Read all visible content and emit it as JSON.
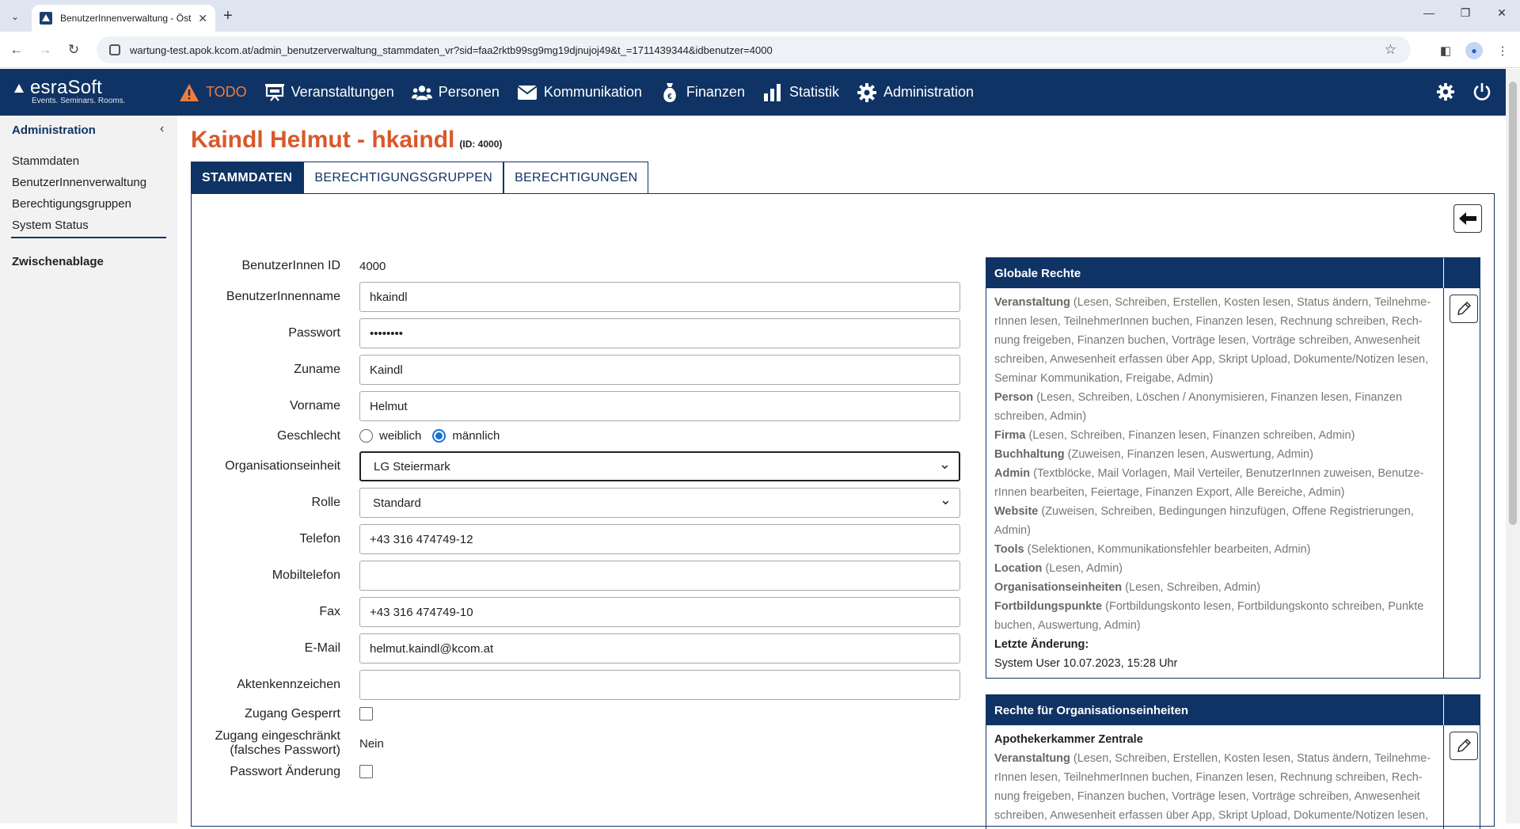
{
  "browser": {
    "tab_title": "BenutzerInnenverwaltung - Öst",
    "tab_close": "✕",
    "new_tab": "+",
    "url": "wartung-test.apok.kcom.at/admin_benutzerverwaltung_stammdaten_vr?sid=faa2rktb99sg9mg19djnujoj49&t_=1711439344&idbenutzer=4000",
    "win_minimize": "—",
    "win_restore": "❐",
    "win_close": "✕"
  },
  "app": {
    "logo": "esraSoft",
    "logo_tagline": "Events. Seminars. Rooms.",
    "menu": [
      {
        "label": "TODO",
        "icon": "warning-icon"
      },
      {
        "label": "Veranstaltungen",
        "icon": "presentation-icon"
      },
      {
        "label": "Personen",
        "icon": "people-icon"
      },
      {
        "label": "Kommunikation",
        "icon": "envelope-icon"
      },
      {
        "label": "Finanzen",
        "icon": "money-bag-icon"
      },
      {
        "label": "Statistik",
        "icon": "bar-chart-icon"
      },
      {
        "label": "Administration",
        "icon": "gear-icon"
      }
    ],
    "colors": {
      "header": "#0f3364",
      "accent": "#d9582a",
      "todo": "#f07d3e"
    }
  },
  "sidebar": {
    "heading": "Administration",
    "items": [
      "Stammdaten",
      "BenutzerInnenverwaltung",
      "Berechtigungsgruppen",
      "System Status"
    ],
    "clipboard": "Zwischenablage"
  },
  "page": {
    "title": "Kaindl Helmut - hkaindl",
    "id_label": "(ID: 4000)",
    "tabs": [
      "STAMMDATEN",
      "BERECHTIGUNGSGRUPPEN",
      "BERECHTIGUNGEN"
    ]
  },
  "form": {
    "id_label": "BenutzerInnen ID",
    "id_value": "4000",
    "username_label": "BenutzerInnenname",
    "username_value": "hkaindl",
    "password_label": "Passwort",
    "password_value": "••••••••",
    "lastname_label": "Zuname",
    "lastname_value": "Kaindl",
    "firstname_label": "Vorname",
    "firstname_value": "Helmut",
    "gender_label": "Geschlecht",
    "gender_female": "weiblich",
    "gender_male": "männlich",
    "org_label": "Organisationseinheit",
    "org_value": "LG Steiermark",
    "role_label": "Rolle",
    "role_value": "Standard",
    "phone_label": "Telefon",
    "phone_value": "+43 316 474749-12",
    "mobile_label": "Mobiltelefon",
    "mobile_value": "",
    "fax_label": "Fax",
    "fax_value": "+43 316 474749-10",
    "email_label": "E-Mail",
    "email_value": "helmut.kaindl@kcom.at",
    "fileref_label": "Aktenkennzeichen",
    "fileref_value": "",
    "locked_label": "Zugang Gesperrt",
    "restricted_label_1": "Zugang eingeschränkt",
    "restricted_label_2": "(falsches Passwort)",
    "restricted_value": "Nein",
    "pwchange_label": "Passwort Änderung"
  },
  "global_rights": {
    "title": "Globale Rechte",
    "entries": [
      {
        "name": "Veranstaltung",
        "text": " (Lesen, Schreiben, Erstellen, Kosten lesen, Status ändern, Teilnehme-"
      },
      {
        "name": "",
        "text": "rInnen lesen, TeilnehmerInnen buchen, Finanzen lesen, Rechnung schreiben, Rech-"
      },
      {
        "name": "",
        "text": "nung freigeben, Finanzen buchen, Vorträge lesen, Vorträge schreiben, Anwesenheit"
      },
      {
        "name": "",
        "text": "schreiben, Anwesenheit erfassen über App, Skript Upload, Dokumente/Notizen lesen,"
      },
      {
        "name": "",
        "text": "Seminar Kommunikation, Freigabe, Admin)"
      },
      {
        "name": "Person",
        "text": " (Lesen, Schreiben, Löschen / Anonymisieren, Finanzen lesen, Finanzen"
      },
      {
        "name": "",
        "text": "schreiben, Admin)"
      },
      {
        "name": "Firma",
        "text": " (Lesen, Schreiben, Finanzen lesen, Finanzen schreiben, Admin)"
      },
      {
        "name": "Buchhaltung",
        "text": " (Zuweisen, Finanzen lesen, Auswertung, Admin)"
      },
      {
        "name": "Admin",
        "text": " (Textblöcke, Mail Vorlagen, Mail Verteiler, BenutzerInnen zuweisen, Benutze-"
      },
      {
        "name": "",
        "text": "rInnen bearbeiten, Feiertage, Finanzen Export, Alle Bereiche, Admin)"
      },
      {
        "name": "Website",
        "text": " (Zuweisen, Schreiben, Bedingungen hinzufügen, Offene Registrierungen,"
      },
      {
        "name": "",
        "text": "Admin)"
      },
      {
        "name": "Tools",
        "text": " (Selektionen, Kommunikationsfehler bearbeiten, Admin)"
      },
      {
        "name": "Location",
        "text": " (Lesen, Admin)"
      },
      {
        "name": "Organisationseinheiten",
        "text": " (Lesen, Schreiben, Admin)"
      },
      {
        "name": "Fortbildungspunkte",
        "text": " (Fortbildungskonto lesen, Fortbildungskonto schreiben, Punkte"
      },
      {
        "name": "",
        "text": "buchen, Auswertung, Admin)"
      }
    ],
    "last_change_label": "Letzte Änderung:",
    "last_change_value": "System User 10.07.2023, 15:28 Uhr"
  },
  "org_rights": {
    "title": "Rechte für Organisationseinheiten",
    "unit": "Apothekerkammer Zentrale",
    "entries": [
      {
        "name": "Veranstaltung",
        "text": " (Lesen, Schreiben, Erstellen, Kosten lesen, Status ändern, Teilnehme-"
      },
      {
        "name": "",
        "text": "rInnen lesen, TeilnehmerInnen buchen, Finanzen lesen, Rechnung schreiben, Rech-"
      },
      {
        "name": "",
        "text": "nung freigeben, Finanzen buchen, Vorträge lesen, Vorträge schreiben, Anwesenheit"
      },
      {
        "name": "",
        "text": "schreiben, Anwesenheit erfassen über App, Skript Upload, Dokumente/Notizen lesen,"
      }
    ]
  }
}
